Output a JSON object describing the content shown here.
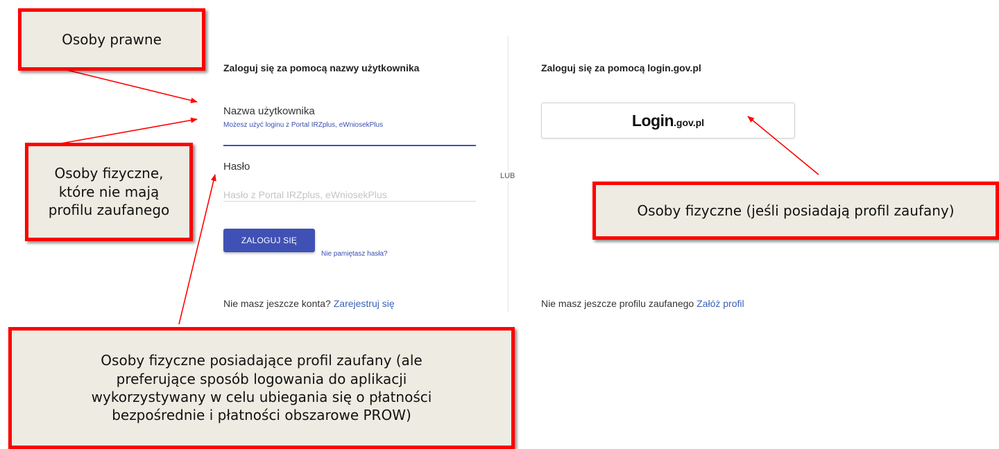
{
  "login_form": {
    "title": "Zaloguj się za pomocą nazwy użytkownika",
    "username_label": "Nazwa użytkownika",
    "username_hint": "Możesz użyć loginu z Portal IRZplus, eWniosekPlus",
    "username_value": "",
    "password_label": "Hasło",
    "password_placeholder": "Hasło z Portal IRZplus, eWniosekPlus",
    "submit_label": "ZALOGUJ SIĘ",
    "forgot_link": "Nie pamiętasz  hasła?",
    "no_account_text": "Nie masz jeszcze konta?",
    "register_link": "Zarejestruj się"
  },
  "separator": {
    "text": "LUB"
  },
  "login_gov": {
    "title": "Zaloguj się za pomocą login.gov.pl",
    "button_logo_main": "Login",
    "button_logo_domain": ".gov.pl",
    "no_profile_text": "Nie masz jeszcze profilu zaufanego",
    "create_profile_link": "Załóż profil"
  },
  "annotations": {
    "legal_persons": "Osoby prawne",
    "natural_no_profile": [
      "Osoby fizyczne,",
      "które nie mają",
      "profilu zaufanego"
    ],
    "natural_with_profile": "Osoby fizyczne (jeśli posiadają profil zaufany)",
    "natural_profile_preferring": [
      "Osoby fizyczne posiadające profil zaufany (ale",
      "preferujące sposób logowania do aplikacji",
      "wykorzystywany w celu ubiegania się o płatności",
      "bezpośrednie i płatności obszarowe PROW)"
    ]
  },
  "colors": {
    "primary": "#3f51b5",
    "link": "#3a62b8",
    "annotation_border": "#ff0000",
    "annotation_fill": "#eeece2"
  }
}
